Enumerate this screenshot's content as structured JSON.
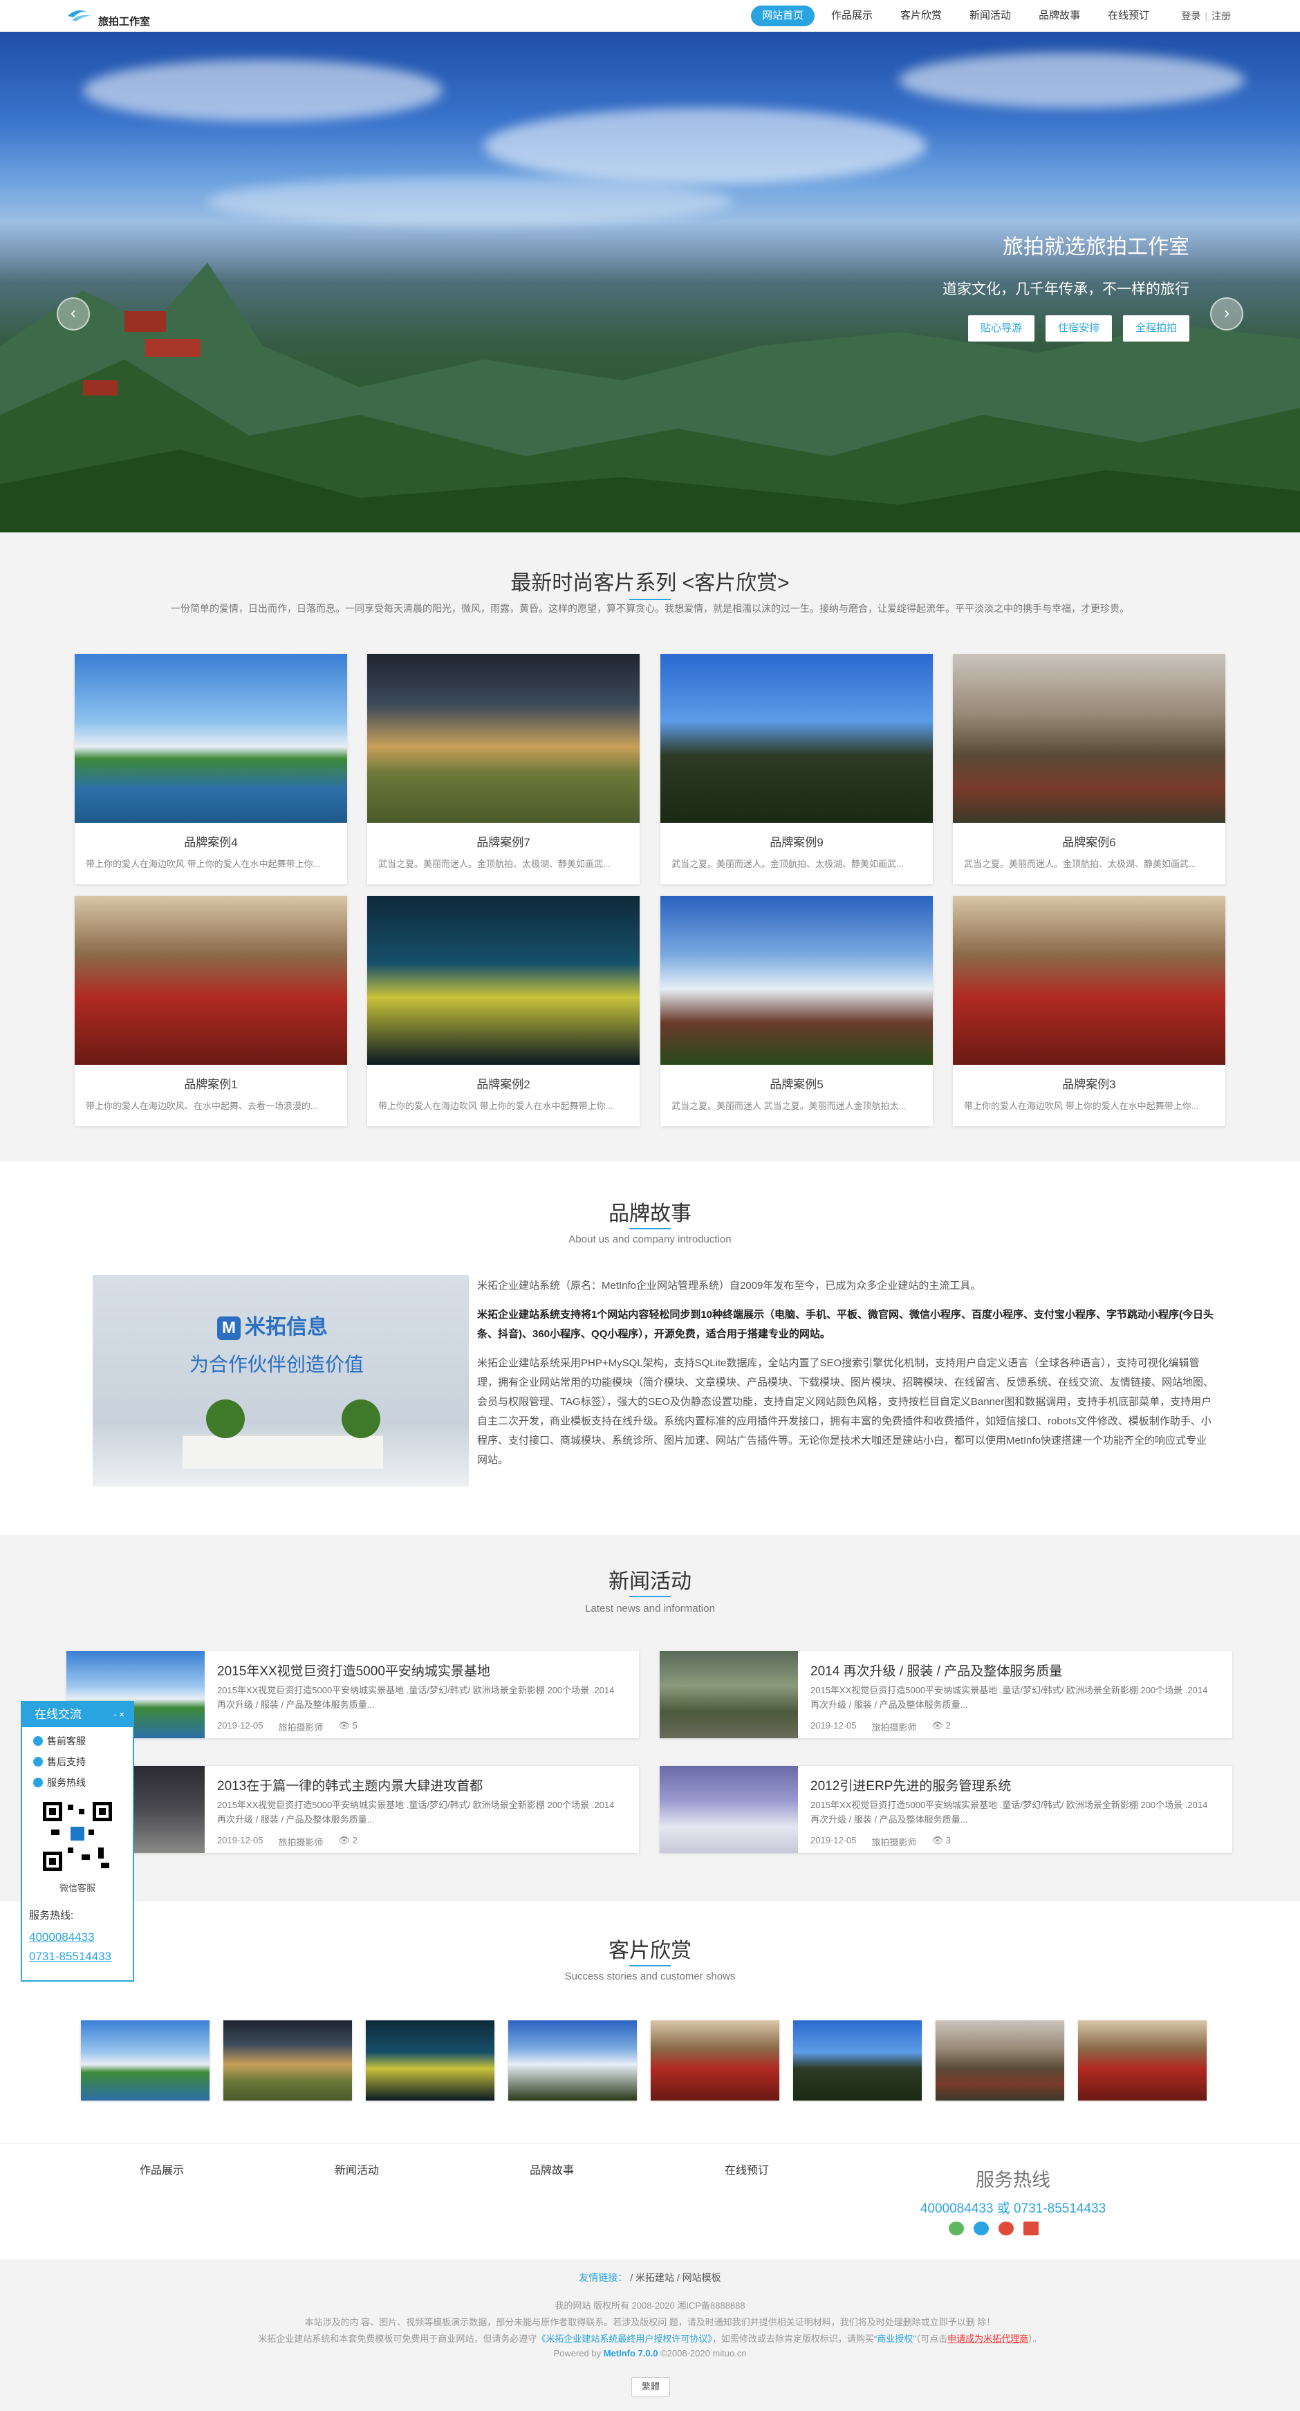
{
  "header": {
    "logo_text": "旅拍工作室",
    "nav": [
      "网站首页",
      "作品展示",
      "客片欣赏",
      "新闻活动",
      "品牌故事",
      "在线预订"
    ],
    "login": "登录",
    "register": "注册"
  },
  "banner": {
    "title": "旅拍就选旅拍工作室",
    "subtitle": "道家文化，几千年传承，不一样的旅行",
    "buttons": [
      "贴心导游",
      "住宿安排",
      "全程拍拍"
    ],
    "prev": "‹",
    "next": "›"
  },
  "cases": {
    "title": "最新时尚客片系列 <客片欣赏>",
    "intro": "一份简单的爱情，日出而作，日落而息。一同享受每天清晨的阳光，微风，雨露，黄昏。这样的愿望，算不算贪心。我想爱情，就是相濡以沫的过一生。接纳与磨合，让爱绽得起流年。平平淡淡之中的携手与幸福，才更珍贵。",
    "items": [
      {
        "name": "品牌案例4",
        "desc": "带上你的爱人在海边吹风 带上你的爱人在水中起舞带上你..."
      },
      {
        "name": "品牌案例7",
        "desc": "武当之夏。美丽而迷人。金顶航拍、太极湖、静美如画武..."
      },
      {
        "name": "品牌案例9",
        "desc": "武当之夏。美丽而迷人。金顶航拍、太极湖、静美如画武..."
      },
      {
        "name": "品牌案例6",
        "desc": "武当之夏。美丽而迷人。金顶航拍、太极湖、静美如画武..."
      },
      {
        "name": "品牌案例1",
        "desc": "带上你的爱人在海边吹风、在水中起舞、去看一场浪漫的..."
      },
      {
        "name": "品牌案例2",
        "desc": "带上你的爱人在海边吹风 带上你的爱人在水中起舞带上你..."
      },
      {
        "name": "品牌案例5",
        "desc": "武当之夏。美丽而迷人 武当之夏。美丽而迷人金顶航拍太..."
      },
      {
        "name": "品牌案例3",
        "desc": "带上你的爱人在海边吹风 带上你的爱人在水中起舞带上你..."
      }
    ]
  },
  "story": {
    "title": "品牌故事",
    "subtitle": "About us and company introduction",
    "image_text_1": "米拓信息",
    "image_text_2": "为合作伙伴创造价值",
    "p1": "米拓企业建站系统（原名：MetInfo企业网站管理系统）自2009年发布至今，已成为众多企业建站的主流工具。",
    "p2": "米拓企业建站系统支持将1个网站内容轻松同步到10种终端展示（电脑、手机、平板、微官网、微信小程序、百度小程序、支付宝小程序、字节跳动小程序(今日头条、抖音)、360小程序、QQ小程序），开源免费，适合用于搭建专业的网站。",
    "p3": "米拓企业建站系统采用PHP+MySQL架构，支持SQLite数据库，全站内置了SEO搜索引擎优化机制，支持用户自定义语言（全球各种语言），支持可视化编辑管理，拥有企业网站常用的功能模块（简介模块、文章模块、产品模块、下载模块、图片模块、招聘模块、在线留言、反馈系统、在线交流、友情链接、网站地图、会员与权限管理、TAG标签），强大的SEO及伪静态设置功能，支持自定义网站颜色风格，支持按栏目自定义Banner图和数据调用，支持手机底部菜单，支持用户自主二次开发，商业模板支持在线升级。系统内置标准的应用插件开发接口，拥有丰富的免费插件和收费插件，如短信接口、robots文件修改、模板制作助手、小程序、支付接口、商城模块、系统诊所、图片加速、网站广告插件等。无论你是技术大咖还是建站小白，都可以使用MetInfo快速搭建一个功能齐全的响应式专业网站。"
  },
  "news": {
    "title": "新闻活动",
    "subtitle": "Latest news and information",
    "items": [
      {
        "title": "2015年XX视觉巨资打造5000平安纳城实景基地",
        "desc": "2015年XX视觉巨资打造5000平安纳城实景基地 .童话/梦幻/韩式/ 欧洲场景全新影棚 200个场景 .2014 再次升级 / 服装 / 产品及整体服务质量...",
        "date": "2019-12-05",
        "author": "旅拍摄影师",
        "views": "5"
      },
      {
        "title": "2014 再次升级 / 服装 / 产品及整体服务质量",
        "desc": "2015年XX视觉巨资打造5000平安纳城实景基地 .童话/梦幻/韩式/ 欧洲场景全新影棚 200个场景 .2014 再次升级 / 服装 / 产品及整体服务质量...",
        "date": "2019-12-05",
        "author": "旅拍摄影师",
        "views": "2"
      },
      {
        "title": "2013在于篇一律的韩式主题内景大肆进攻首都",
        "desc": "2015年XX视觉巨资打造5000平安纳城实景基地 .童话/梦幻/韩式/ 欧洲场景全新影棚 200个场景 .2014 再次升级 / 服装 / 产品及整体服务质量...",
        "date": "2019-12-05",
        "author": "旅拍摄影师",
        "views": "2"
      },
      {
        "title": "2012引进ERP先进的服务管理系统",
        "desc": "2015年XX视觉巨资打造5000平安纳城实景基地 .童话/梦幻/韩式/ 欧洲场景全新影棚 200个场景 .2014 再次升级 / 服装 / 产品及整体服务质量...",
        "date": "2019-12-05",
        "author": "旅拍摄影师",
        "views": "3"
      }
    ]
  },
  "service": {
    "title": "在线交流",
    "controls": "- ×",
    "items": [
      "售前客服",
      "售后支持",
      "服务热线"
    ],
    "qr_label": "微信客服",
    "hotline_label": "服务热线:",
    "phone1": "4000084433",
    "phone2": "0731-85514433"
  },
  "show": {
    "title": "客片欣赏",
    "subtitle": "Success stories and customer shows"
  },
  "footer": {
    "nav": [
      "作品展示",
      "新闻活动",
      "品牌故事",
      "在线预订"
    ],
    "hot_title": "服务热线",
    "hot_nums": "4000084433 或 0731-85514433",
    "friend_label": "友情链接：",
    "friends": [
      "米拓建站",
      "网站模板"
    ],
    "line1": "我的网站 版权所有 2008-2020 湘ICP备8888888",
    "line2": "本站涉及的内 容、图片、视频等模板演示数据，部分未能与原作者取得联系。若涉及版权问 题，请及时通知我们并提供相关证明材料，我们将及时处理删除或立即予以删 除！",
    "line3_a": "米拓企业建站系统和本套免费模板可免费用于商业网站，但请务必遵守",
    "line3_link": "《米拓企业建站系统最终用户授权许可协议》",
    "line3_b": "，如需修改或去除肯定版权标识，请购买",
    "line3_link2": "“商业授权”",
    "line3_c": "（可点击",
    "line3_red": "申请成为米拓代理商",
    "line3_d": "）。",
    "powered_a": "Powered by ",
    "powered_b": "MetInfo 7.0.0",
    "powered_c": " ©2008-2020  mituo.cn",
    "lang": "繁體"
  }
}
